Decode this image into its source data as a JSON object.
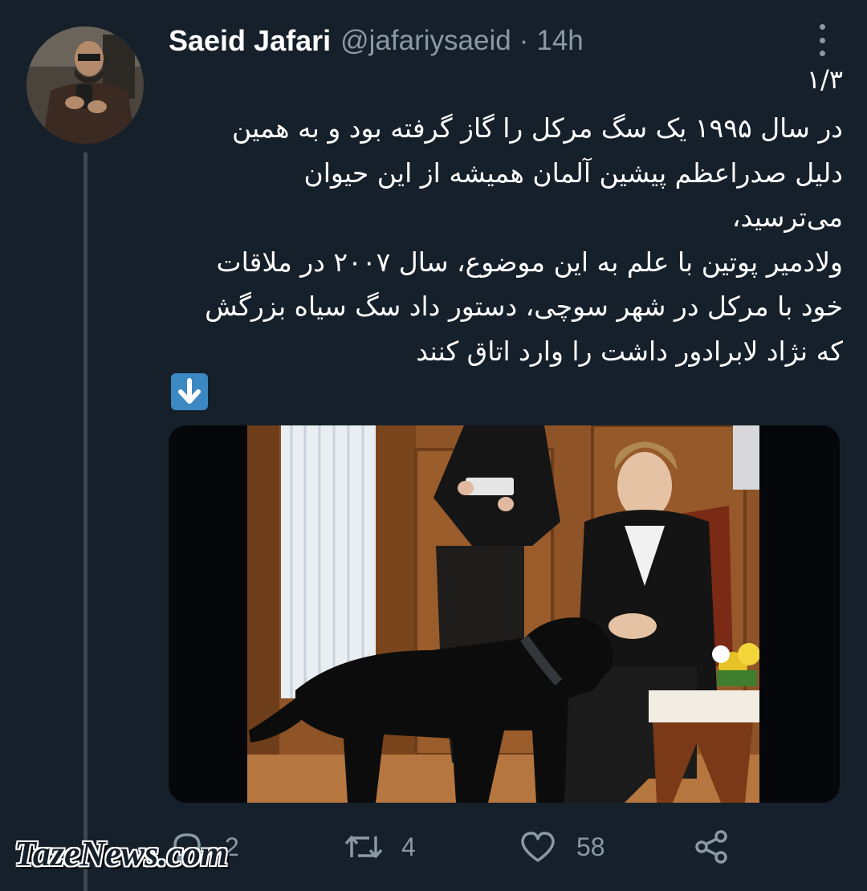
{
  "tweet": {
    "author_name": "Saeid Jafari",
    "author_handle": "@jafariysaeid",
    "separator": "·",
    "time": "14h",
    "thread_counter": "۱/۳",
    "body_lines": [
      "در سال ۱۹۹۵ یک سگ مرکل را گاز گرفته بود و به همین",
      "دلیل صدراعظم پیشین آلمان همیشه از این حیوان",
      "می‌ترسید،",
      "ولادمیر پوتین با علم به این موضوع، سال ۲۰۰۷ در ملاقات",
      "خود با مرکل در شهر سوچی، دستور داد سگ سیاه بزرگش",
      "که نژاد لابرادور داشت را وارد اتاق کنند"
    ],
    "emoji_icon": "down-arrow-emoji-icon",
    "actions": {
      "reply_count": "2",
      "retweet_count": "4",
      "like_count": "58"
    }
  },
  "watermark": "TazeNews.com",
  "colors": {
    "background": "#16202b",
    "text": "#ffffff",
    "secondary": "#8b98a5",
    "thread_line": "#3a4856"
  }
}
